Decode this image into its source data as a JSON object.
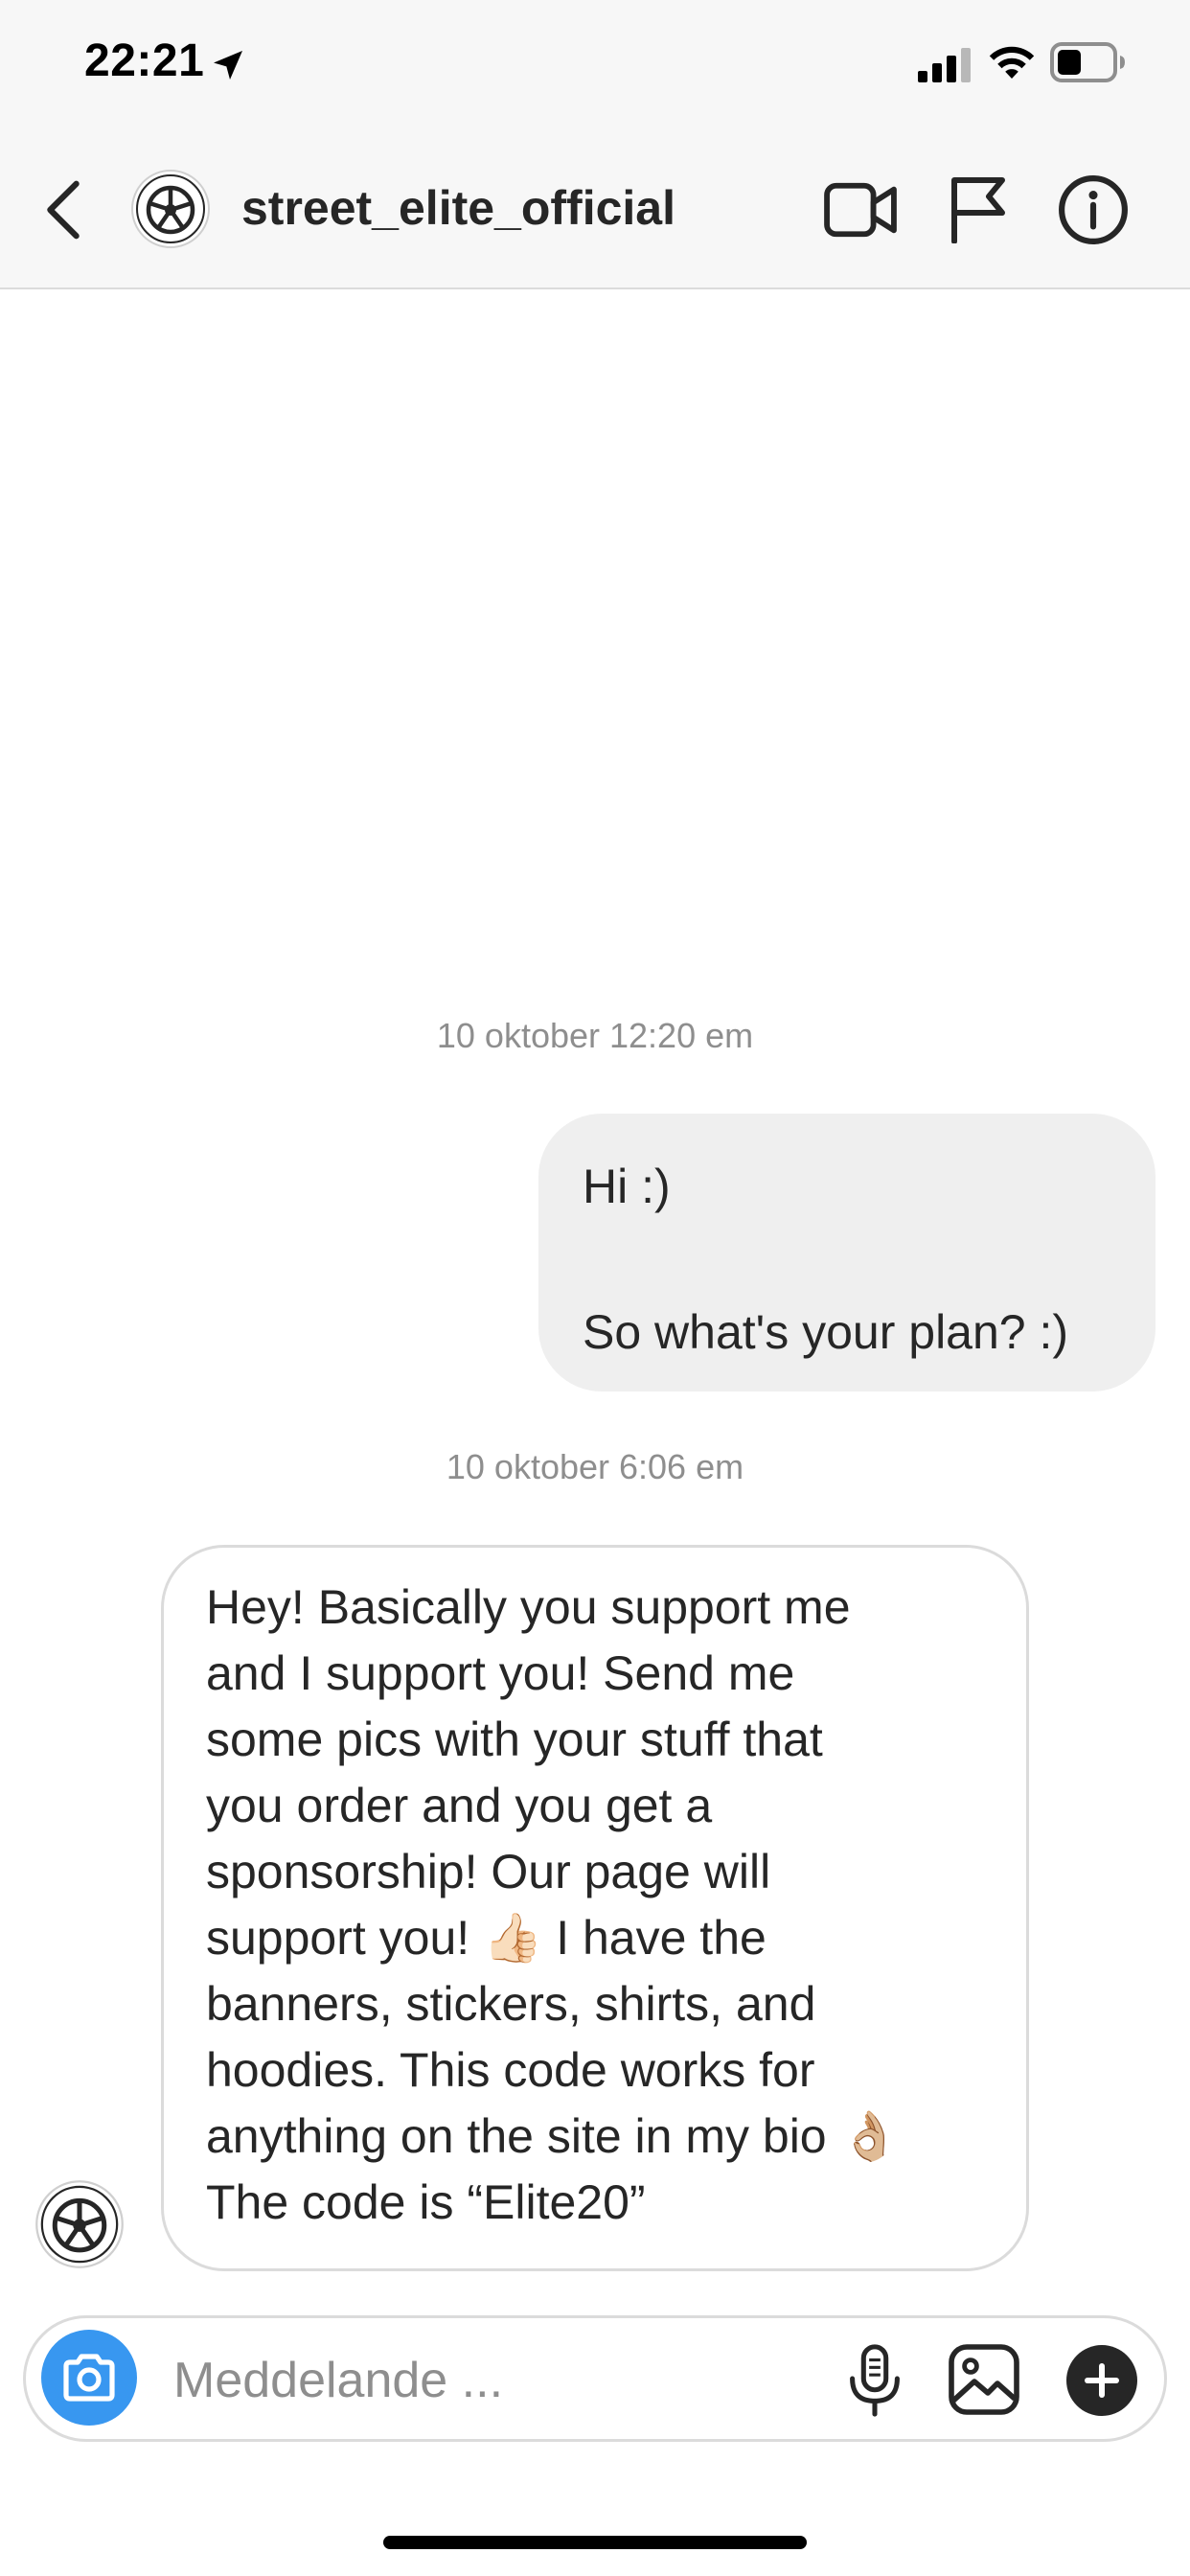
{
  "status_bar": {
    "time": "22:21"
  },
  "header": {
    "username": "street_elite_official"
  },
  "messages": [
    {
      "type": "timestamp",
      "text": "10 oktober 12:20 em"
    },
    {
      "type": "outgoing",
      "lines": [
        "Hi :)",
        "So what's your plan? :)"
      ]
    },
    {
      "type": "timestamp",
      "text": "10 oktober 6:06 em"
    },
    {
      "type": "incoming",
      "text": "Hey! Basically you support me\nand I support you! Send me\nsome pics with your stuff that\nyou order and you get a\nsponsorship! Our page will\nsupport you! 👍🏻 I have the\nbanners, stickers, shirts, and\nhoodies. This code works for\nanything on the site in my bio 👌🏼\nThe code is “Elite20”"
    }
  ],
  "composer": {
    "placeholder": "Meddelande ..."
  },
  "colors": {
    "accent": "#3897f0",
    "bar_bg": "#f7f7f7",
    "bubble_out_bg": "#efefef",
    "text": "#262626",
    "muted": "#8e8e8e"
  },
  "icons": [
    "location-arrow-icon",
    "signal-icon",
    "wifi-icon",
    "battery-icon",
    "chevron-left-icon",
    "video-camera-icon",
    "flag-icon",
    "info-icon",
    "camera-icon",
    "microphone-icon",
    "image-icon",
    "plus-icon"
  ]
}
